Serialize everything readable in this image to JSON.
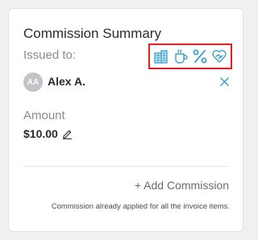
{
  "header": {
    "title": "Commission Summary",
    "issued_to_label": "Issued to:"
  },
  "commission_type_icons": [
    {
      "name": "building-icon"
    },
    {
      "name": "coffee-cup-icon"
    },
    {
      "name": "percent-icon"
    },
    {
      "name": "heart-handshake-icon"
    }
  ],
  "recipient": {
    "initials": "AA",
    "name": "Alex A."
  },
  "amount": {
    "label": "Amount",
    "value": "$10.00"
  },
  "actions": {
    "add_commission": "+ Add Commission"
  },
  "footer": {
    "note": "Commission already applied for all the invoice items."
  },
  "colors": {
    "accent": "#3aa0c8",
    "highlight_border": "#e02020",
    "avatar_bg": "#c4c4c8"
  }
}
